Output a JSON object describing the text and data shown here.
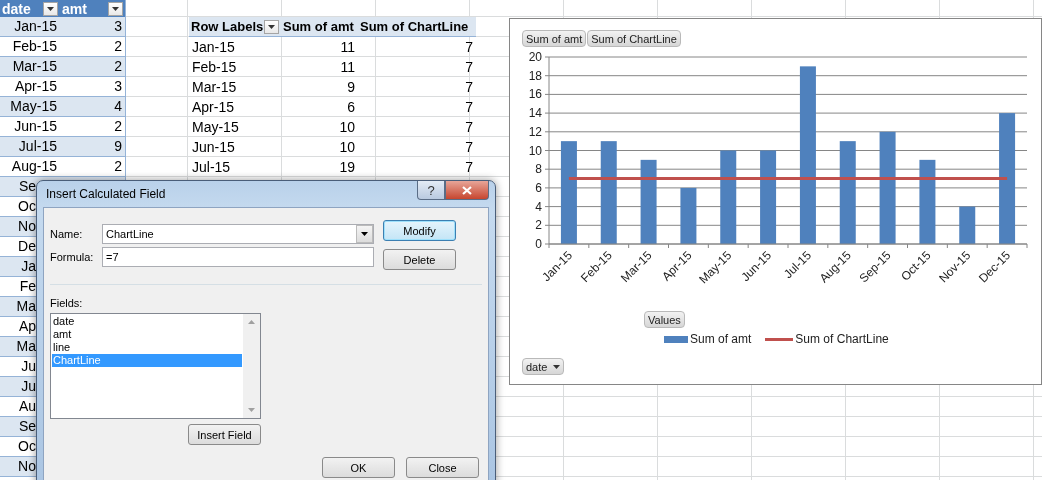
{
  "sheet": {
    "data_table": {
      "columns": [
        {
          "label": "date"
        },
        {
          "label": "amt"
        }
      ],
      "rows": [
        {
          "cells": [
            "Jan-15",
            "3"
          ]
        },
        {
          "cells": [
            "Feb-15",
            "2"
          ]
        },
        {
          "cells": [
            "Mar-15",
            "2"
          ]
        },
        {
          "cells": [
            "Apr-15",
            "3"
          ]
        },
        {
          "cells": [
            "May-15",
            "4"
          ]
        },
        {
          "cells": [
            "Jun-15",
            "2"
          ]
        },
        {
          "cells": [
            "Jul-15",
            "9"
          ]
        },
        {
          "cells": [
            "Aug-15",
            "2"
          ]
        },
        {
          "cells": [
            "Se"
          ]
        },
        {
          "cells": [
            "Oc"
          ]
        },
        {
          "cells": [
            "No"
          ]
        },
        {
          "cells": [
            "De"
          ]
        },
        {
          "cells": [
            "Ja"
          ]
        },
        {
          "cells": [
            "Fe"
          ]
        },
        {
          "cells": [
            "Ma"
          ]
        },
        {
          "cells": [
            "Ap"
          ]
        },
        {
          "cells": [
            "Ma"
          ]
        },
        {
          "cells": [
            "Ju"
          ]
        },
        {
          "cells": [
            "Ju"
          ]
        },
        {
          "cells": [
            "Au"
          ]
        },
        {
          "cells": [
            "Se"
          ]
        },
        {
          "cells": [
            "Oc"
          ]
        },
        {
          "cells": [
            "No"
          ]
        }
      ]
    },
    "pivot_table": {
      "columns": [
        {
          "label": "Row Labels",
          "filter_button": true
        },
        {
          "label": "Sum of amt",
          "filter_button": false
        },
        {
          "label": "Sum of ChartLine",
          "filter_button": false
        }
      ],
      "rows": [
        {
          "cells": [
            "Jan-15",
            "11",
            "7"
          ]
        },
        {
          "cells": [
            "Feb-15",
            "11",
            "7"
          ]
        },
        {
          "cells": [
            "Mar-15",
            "9",
            "7"
          ]
        },
        {
          "cells": [
            "Apr-15",
            "6",
            "7"
          ]
        },
        {
          "cells": [
            "May-15",
            "10",
            "7"
          ]
        },
        {
          "cells": [
            "Jun-15",
            "10",
            "7"
          ]
        },
        {
          "cells": [
            "Jul-15",
            "19",
            "7"
          ]
        }
      ]
    }
  },
  "chart": {
    "value_buttons": [
      "Sum of amt",
      "Sum of ChartLine"
    ],
    "legend_field_button": "Values",
    "axis_field_button": "date",
    "chart_data": {
      "type": "bar",
      "grid": true,
      "categories": [
        "Jan-15",
        "Feb-15",
        "Mar-15",
        "Apr-15",
        "May-15",
        "Jun-15",
        "Jul-15",
        "Aug-15",
        "Sep-15",
        "Oct-15",
        "Nov-15",
        "Dec-15"
      ],
      "ylim": [
        0,
        20
      ],
      "yticks": [
        0,
        2,
        4,
        6,
        8,
        10,
        12,
        14,
        16,
        18,
        20
      ],
      "series": [
        {
          "name": "Sum of amt",
          "type": "bar",
          "color": "#4f81bd",
          "values": [
            11,
            11,
            9,
            6,
            10,
            10,
            19,
            11,
            12,
            9,
            4,
            14
          ]
        },
        {
          "name": "Sum of ChartLine",
          "type": "line",
          "color": "#c0504d",
          "values": [
            7,
            7,
            7,
            7,
            7,
            7,
            7,
            7,
            7,
            7,
            7,
            7
          ]
        }
      ]
    }
  },
  "dialog": {
    "title": "Insert Calculated Field",
    "help_button": "?",
    "name_label": "Name:",
    "name_value": "ChartLine",
    "formula_label": "Formula:",
    "formula_value": "=7",
    "side_buttons": [
      {
        "label": "Modify",
        "default": true
      },
      {
        "label": "Delete",
        "default": false
      }
    ],
    "fields_label": "Fields:",
    "fields": [
      {
        "label": "date",
        "selected": false
      },
      {
        "label": "amt",
        "selected": false
      },
      {
        "label": "line",
        "selected": false
      },
      {
        "label": "ChartLine",
        "selected": true
      }
    ],
    "insert_button": "Insert Field",
    "footer_buttons": [
      {
        "label": "OK",
        "default": false
      },
      {
        "label": "Close",
        "default": false
      }
    ]
  }
}
